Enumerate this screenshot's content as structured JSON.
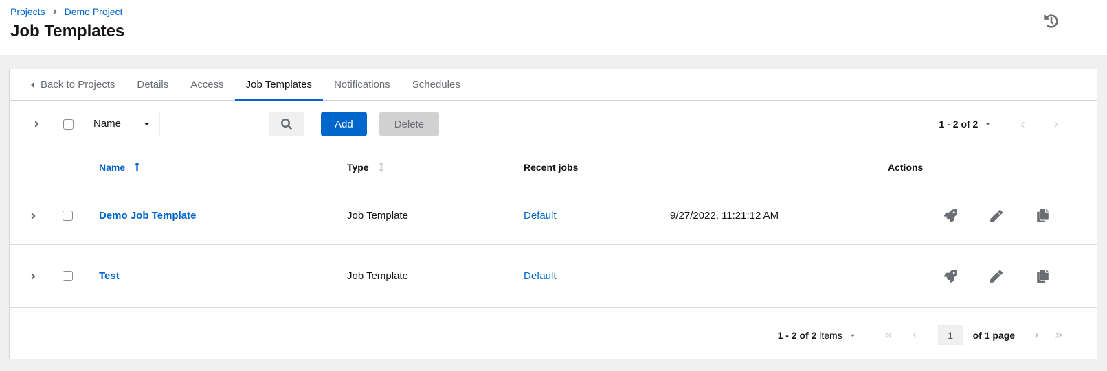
{
  "header": {
    "breadcrumb": [
      {
        "label": "Projects"
      },
      {
        "label": "Demo Project"
      }
    ],
    "title": "Job Templates"
  },
  "tabs": {
    "back_label": "Back to Projects",
    "items": [
      {
        "label": "Details",
        "active": false
      },
      {
        "label": "Access",
        "active": false
      },
      {
        "label": "Job Templates",
        "active": true
      },
      {
        "label": "Notifications",
        "active": false
      },
      {
        "label": "Schedules",
        "active": false
      }
    ]
  },
  "toolbar": {
    "filter_selected": "Name",
    "search_value": "",
    "search_placeholder": "",
    "add_label": "Add",
    "delete_label": "Delete",
    "pagination_summary": "1 - 2 of 2"
  },
  "table": {
    "headers": {
      "name": "Name",
      "type": "Type",
      "recent_jobs": "Recent jobs",
      "actions": "Actions"
    },
    "sort": {
      "column": "Name",
      "direction": "ascending"
    },
    "rows": [
      {
        "name": "Demo Job Template",
        "type": "Job Template",
        "recent_jobs": "Default",
        "last_ran": "9/27/2022, 11:21:12 AM"
      },
      {
        "name": "Test",
        "type": "Job Template",
        "recent_jobs": "Default",
        "last_ran": ""
      }
    ]
  },
  "footer_pagination": {
    "summary": "1 - 2 of 2",
    "summary_suffix": " items",
    "page_value": "1",
    "of_pages": "of 1 page"
  },
  "glyphs": {
    "first_page": "«",
    "prev_page": "‹",
    "next_page": "›",
    "last_page": "»"
  },
  "colors": {
    "link": "#0066cc",
    "primary_button": "#0066cc",
    "active_tab_underline": "#0066cc",
    "disabled_button_bg": "#d2d2d2",
    "muted_text": "#6a6e73",
    "page_background": "#f0f0f0"
  }
}
